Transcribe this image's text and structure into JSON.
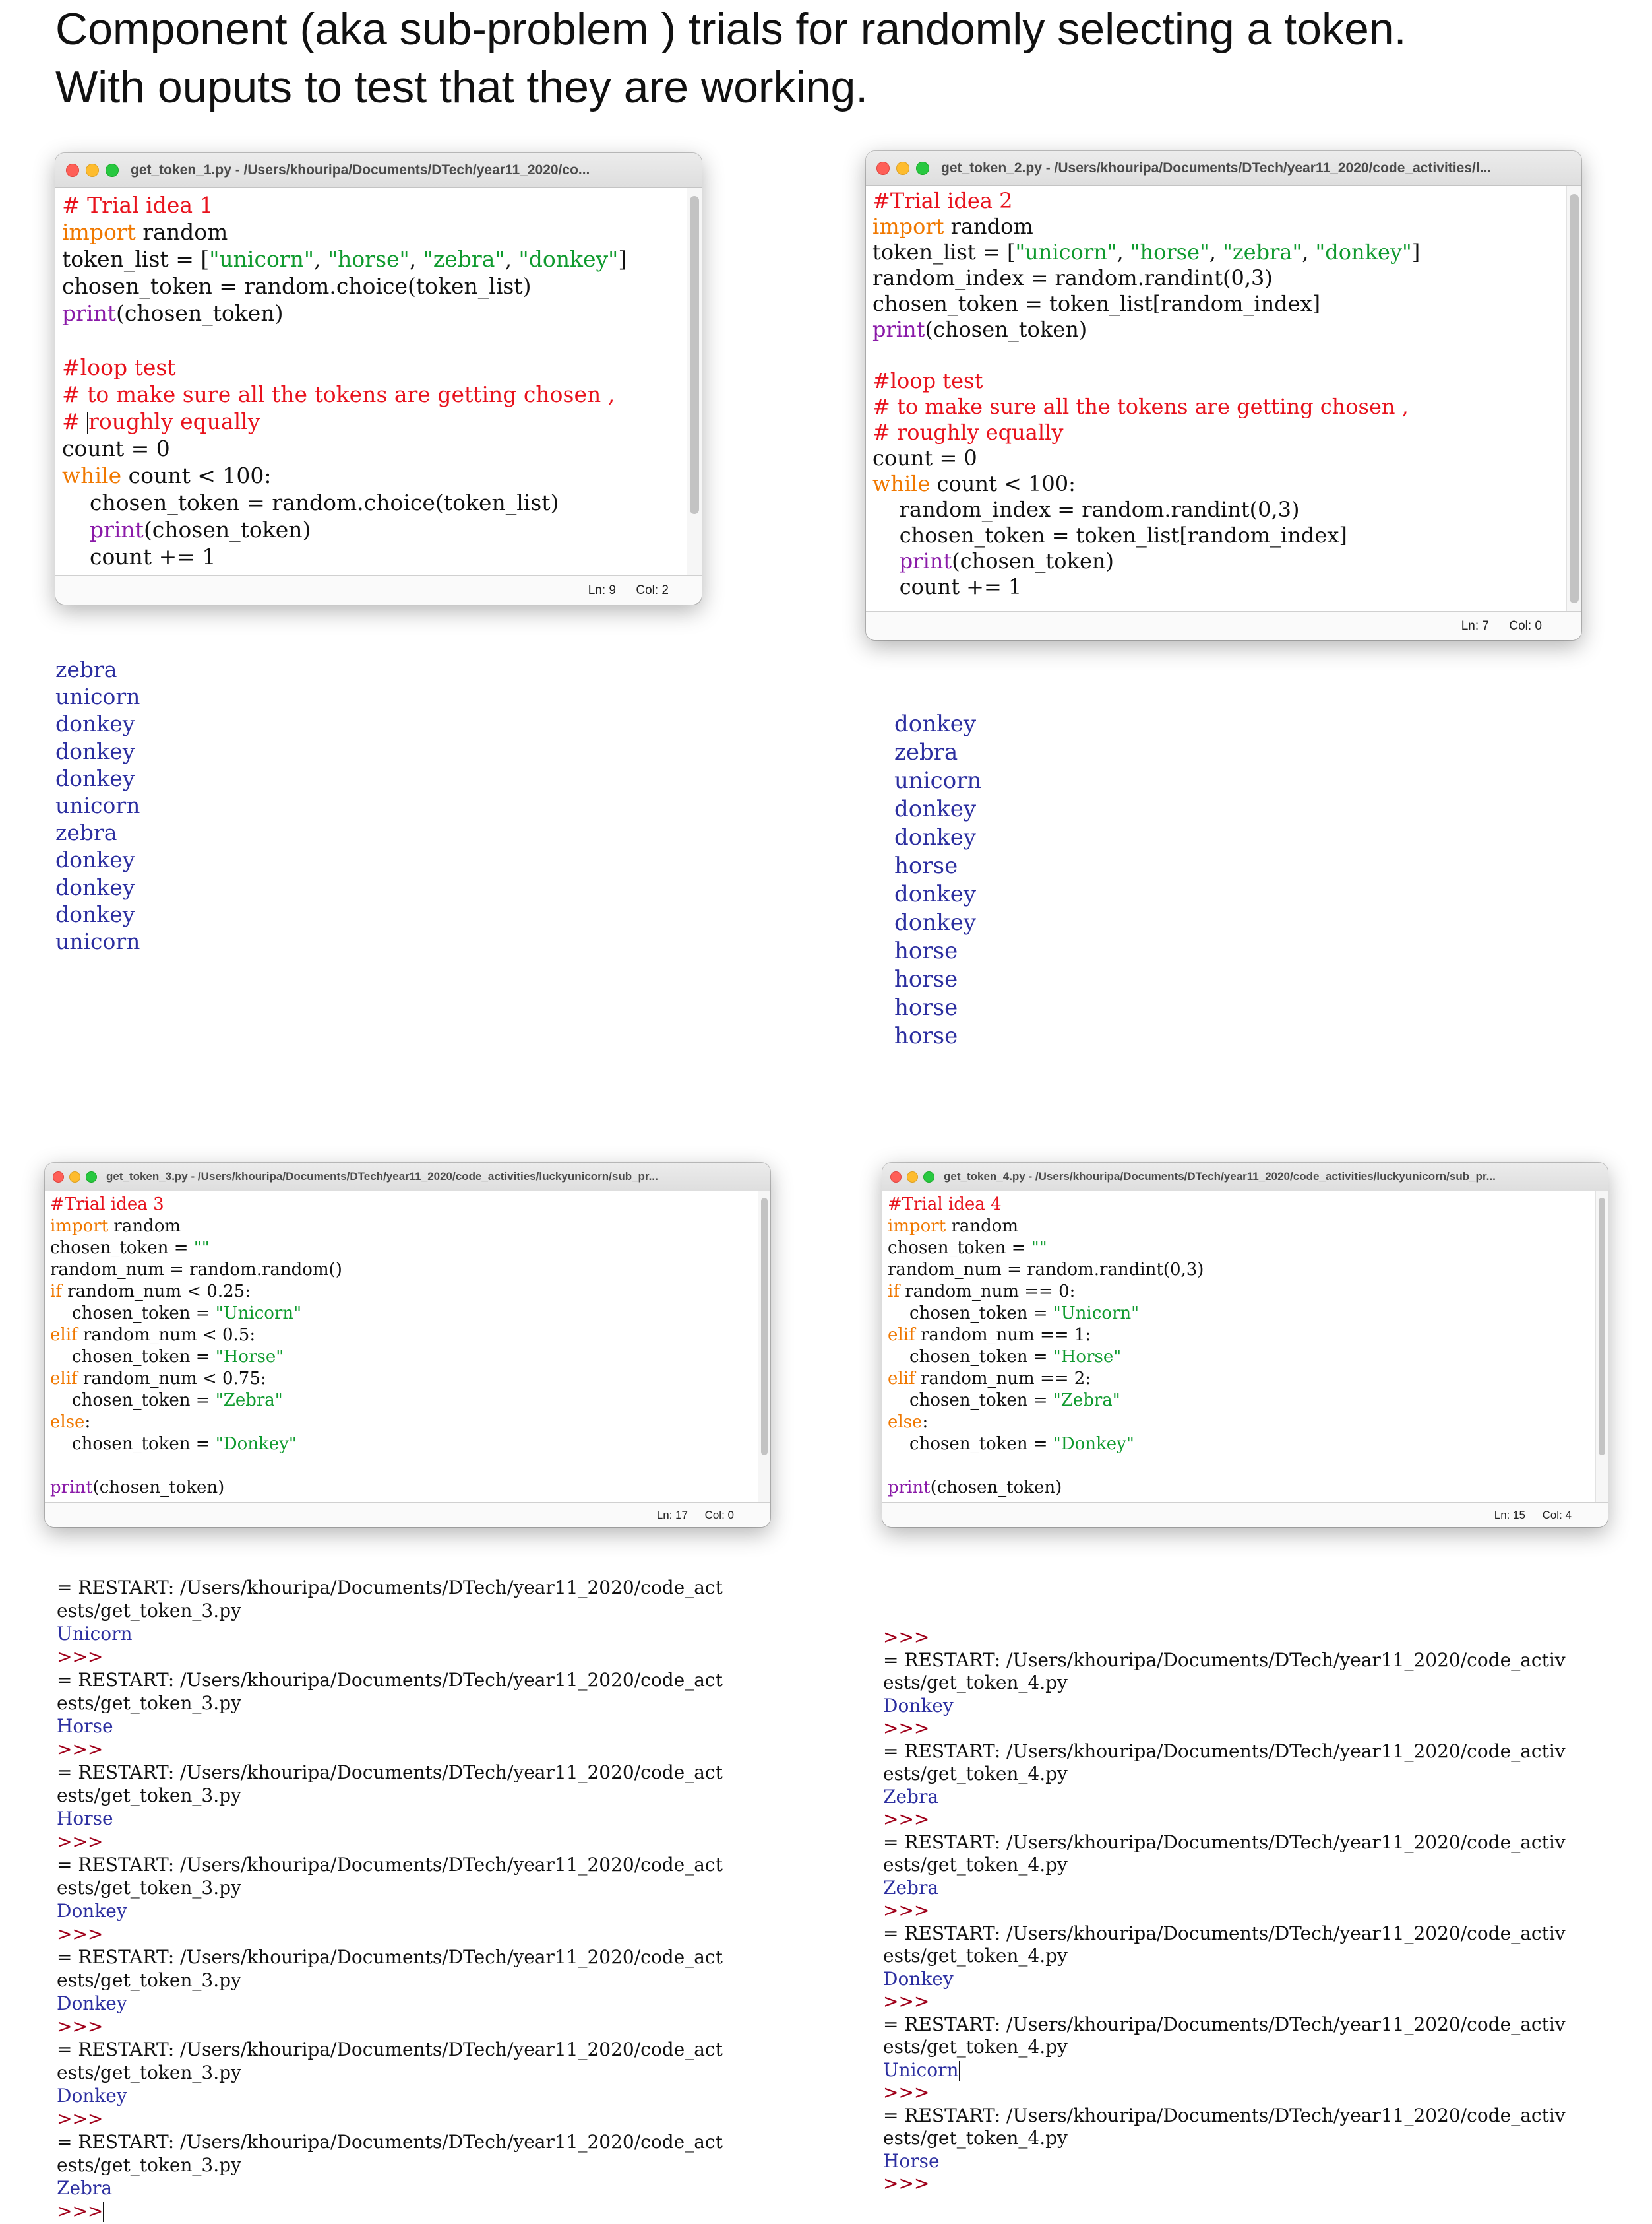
{
  "heading": {
    "line1": "Component (aka sub-problem ) trials for  randomly selecting a token.",
    "line2": "With ouputs to test that they are working."
  },
  "windows": [
    {
      "title": "get_token_1.py - /Users/khouripa/Documents/DTech/year11_2020/co...",
      "status_ln": "Ln: 9",
      "status_col": "Col: 2",
      "code": [
        [
          {
            "t": "# Trial idea 1",
            "c": "cm"
          }
        ],
        [
          {
            "t": "import",
            "c": "kw"
          },
          {
            "t": " random"
          }
        ],
        [
          {
            "t": "token_list = ["
          },
          {
            "t": "\"unicorn\"",
            "c": "st"
          },
          {
            "t": ", "
          },
          {
            "t": "\"horse\"",
            "c": "st"
          },
          {
            "t": ", "
          },
          {
            "t": "\"zebra\"",
            "c": "st"
          },
          {
            "t": ", "
          },
          {
            "t": "\"donkey\"",
            "c": "st"
          },
          {
            "t": "]"
          }
        ],
        [
          {
            "t": "chosen_token = random.choice(token_list)"
          }
        ],
        [
          {
            "t": "print",
            "c": "bi"
          },
          {
            "t": "(chosen_token)"
          }
        ],
        [],
        [
          {
            "t": "#loop test",
            "c": "cm"
          }
        ],
        [
          {
            "t": "# to make sure all the tokens are getting chosen ,",
            "c": "cm"
          }
        ],
        [
          {
            "t": "# ",
            "c": "cm"
          },
          {
            "caret": true
          },
          {
            "t": "roughly equally",
            "c": "cm"
          }
        ],
        [
          {
            "t": "count = 0"
          }
        ],
        [
          {
            "t": "while",
            "c": "kw"
          },
          {
            "t": " count < 100:"
          }
        ],
        [
          {
            "t": "    chosen_token = random.choice(token_list)"
          }
        ],
        [
          {
            "t": "    "
          },
          {
            "t": "print",
            "c": "bi"
          },
          {
            "t": "(chosen_token)"
          }
        ],
        [
          {
            "t": "    count += 1"
          }
        ]
      ]
    },
    {
      "title": "get_token_2.py - /Users/khouripa/Documents/DTech/year11_2020/code_activities/l...",
      "status_ln": "Ln: 7",
      "status_col": "Col: 0",
      "code": [
        [
          {
            "t": "#Trial idea 2",
            "c": "cm"
          }
        ],
        [
          {
            "t": "import",
            "c": "kw"
          },
          {
            "t": " random"
          }
        ],
        [
          {
            "t": "token_list = ["
          },
          {
            "t": "\"unicorn\"",
            "c": "st"
          },
          {
            "t": ", "
          },
          {
            "t": "\"horse\"",
            "c": "st"
          },
          {
            "t": ", "
          },
          {
            "t": "\"zebra\"",
            "c": "st"
          },
          {
            "t": ", "
          },
          {
            "t": "\"donkey\"",
            "c": "st"
          },
          {
            "t": "]"
          }
        ],
        [
          {
            "t": "random_index = random.randint(0,3)"
          }
        ],
        [
          {
            "t": "chosen_token = token_list[random_index]"
          }
        ],
        [
          {
            "t": "print",
            "c": "bi"
          },
          {
            "t": "(chosen_token)"
          }
        ],
        [],
        [
          {
            "t": "#loop test",
            "c": "cm"
          }
        ],
        [
          {
            "t": "# to make sure all the tokens are getting chosen ,",
            "c": "cm"
          }
        ],
        [
          {
            "t": "# roughly equally",
            "c": "cm"
          }
        ],
        [
          {
            "t": "count = 0"
          }
        ],
        [
          {
            "t": "while",
            "c": "kw"
          },
          {
            "t": " count < 100:"
          }
        ],
        [
          {
            "t": "    random_index = random.randint(0,3)"
          }
        ],
        [
          {
            "t": "    chosen_token = token_list[random_index]"
          }
        ],
        [
          {
            "t": "    "
          },
          {
            "t": "print",
            "c": "bi"
          },
          {
            "t": "(chosen_token)"
          }
        ],
        [
          {
            "t": "    count += 1"
          }
        ]
      ]
    },
    {
      "title": "get_token_3.py - /Users/khouripa/Documents/DTech/year11_2020/code_activities/luckyunicorn/sub_pr...",
      "status_ln": "Ln: 17",
      "status_col": "Col: 0",
      "code": [
        [
          {
            "t": "#Trial idea 3",
            "c": "cm"
          }
        ],
        [
          {
            "t": "import",
            "c": "kw"
          },
          {
            "t": " random"
          }
        ],
        [
          {
            "t": "chosen_token = "
          },
          {
            "t": "\"\"",
            "c": "st"
          }
        ],
        [
          {
            "t": "random_num = random.random()"
          }
        ],
        [
          {
            "t": "if",
            "c": "kw"
          },
          {
            "t": " random_num < 0.25:"
          }
        ],
        [
          {
            "t": "    chosen_token = "
          },
          {
            "t": "\"Unicorn\"",
            "c": "st"
          }
        ],
        [
          {
            "t": "elif",
            "c": "kw"
          },
          {
            "t": " random_num < 0.5:"
          }
        ],
        [
          {
            "t": "    chosen_token = "
          },
          {
            "t": "\"Horse\"",
            "c": "st"
          }
        ],
        [
          {
            "t": "elif",
            "c": "kw"
          },
          {
            "t": " random_num < 0.75:"
          }
        ],
        [
          {
            "t": "    chosen_token = "
          },
          {
            "t": "\"Zebra\"",
            "c": "st"
          }
        ],
        [
          {
            "t": "else",
            "c": "kw"
          },
          {
            "t": ":"
          }
        ],
        [
          {
            "t": "    chosen_token = "
          },
          {
            "t": "\"Donkey\"",
            "c": "st"
          }
        ],
        [],
        [
          {
            "t": "print",
            "c": "bi"
          },
          {
            "t": "(chosen_token)"
          }
        ]
      ]
    },
    {
      "title": "get_token_4.py - /Users/khouripa/Documents/DTech/year11_2020/code_activities/luckyunicorn/sub_pr...",
      "status_ln": "Ln: 15",
      "status_col": "Col: 4",
      "code": [
        [
          {
            "t": "#Trial idea 4",
            "c": "cm"
          }
        ],
        [
          {
            "t": "import",
            "c": "kw"
          },
          {
            "t": " random"
          }
        ],
        [
          {
            "t": "chosen_token = "
          },
          {
            "t": "\"\"",
            "c": "st"
          }
        ],
        [
          {
            "t": "random_num = random.randint(0,3)"
          }
        ],
        [
          {
            "t": "if",
            "c": "kw"
          },
          {
            "t": " random_num == 0:"
          }
        ],
        [
          {
            "t": "    chosen_token = "
          },
          {
            "t": "\"Unicorn\"",
            "c": "st"
          }
        ],
        [
          {
            "t": "elif",
            "c": "kw"
          },
          {
            "t": " random_num == 1:"
          }
        ],
        [
          {
            "t": "    chosen_token = "
          },
          {
            "t": "\"Horse\"",
            "c": "st"
          }
        ],
        [
          {
            "t": "elif",
            "c": "kw"
          },
          {
            "t": " random_num == 2:"
          }
        ],
        [
          {
            "t": "    chosen_token = "
          },
          {
            "t": "\"Zebra\"",
            "c": "st"
          }
        ],
        [
          {
            "t": "else",
            "c": "kw"
          },
          {
            "t": ":"
          }
        ],
        [
          {
            "t": "    chosen_token = "
          },
          {
            "t": "\"Donkey\"",
            "c": "st"
          }
        ],
        [],
        [
          {
            "t": "print",
            "c": "bi"
          },
          {
            "t": "(chosen_token)"
          }
        ]
      ]
    }
  ],
  "outputs": [
    [
      [
        {
          "t": "zebra",
          "c": "tok"
        }
      ],
      [
        {
          "t": "unicorn",
          "c": "tok"
        }
      ],
      [
        {
          "t": "donkey",
          "c": "tok"
        }
      ],
      [
        {
          "t": "donkey",
          "c": "tok"
        }
      ],
      [
        {
          "t": "donkey",
          "c": "tok"
        }
      ],
      [
        {
          "t": "unicorn",
          "c": "tok"
        }
      ],
      [
        {
          "t": "zebra",
          "c": "tok"
        }
      ],
      [
        {
          "t": "donkey",
          "c": "tok"
        }
      ],
      [
        {
          "t": "donkey",
          "c": "tok"
        }
      ],
      [
        {
          "t": "donkey",
          "c": "tok"
        }
      ],
      [
        {
          "t": "unicorn",
          "c": "tok"
        }
      ]
    ],
    [
      [
        {
          "t": "donkey",
          "c": "tok"
        }
      ],
      [
        {
          "t": "zebra",
          "c": "tok"
        }
      ],
      [
        {
          "t": "unicorn",
          "c": "tok"
        }
      ],
      [
        {
          "t": "donkey",
          "c": "tok"
        }
      ],
      [
        {
          "t": "donkey",
          "c": "tok"
        }
      ],
      [
        {
          "t": "horse",
          "c": "tok"
        }
      ],
      [
        {
          "t": "donkey",
          "c": "tok"
        }
      ],
      [
        {
          "t": "donkey",
          "c": "tok"
        }
      ],
      [
        {
          "t": "horse",
          "c": "tok"
        }
      ],
      [
        {
          "t": "horse",
          "c": "tok"
        }
      ],
      [
        {
          "t": "horse",
          "c": "tok"
        }
      ],
      [
        {
          "t": "horse",
          "c": "tok"
        }
      ]
    ],
    [
      [
        {
          "t": "= RESTART: /Users/khouripa/Documents/DTech/year11_2020/code_act",
          "c": "rs"
        }
      ],
      [
        {
          "t": "ests/get_token_3.py",
          "c": "rs"
        }
      ],
      [
        {
          "t": "Unicorn",
          "c": "tok"
        }
      ],
      [
        {
          "t": ">>>",
          "c": "prompt"
        }
      ],
      [
        {
          "t": "= RESTART: /Users/khouripa/Documents/DTech/year11_2020/code_act",
          "c": "rs"
        }
      ],
      [
        {
          "t": "ests/get_token_3.py",
          "c": "rs"
        }
      ],
      [
        {
          "t": "Horse",
          "c": "tok"
        }
      ],
      [
        {
          "t": ">>>",
          "c": "prompt"
        }
      ],
      [
        {
          "t": "= RESTART: /Users/khouripa/Documents/DTech/year11_2020/code_act",
          "c": "rs"
        }
      ],
      [
        {
          "t": "ests/get_token_3.py",
          "c": "rs"
        }
      ],
      [
        {
          "t": "Horse",
          "c": "tok"
        }
      ],
      [
        {
          "t": ">>>",
          "c": "prompt"
        }
      ],
      [
        {
          "t": "= RESTART: /Users/khouripa/Documents/DTech/year11_2020/code_act",
          "c": "rs"
        }
      ],
      [
        {
          "t": "ests/get_token_3.py",
          "c": "rs"
        }
      ],
      [
        {
          "t": "Donkey",
          "c": "tok"
        }
      ],
      [
        {
          "t": ">>>",
          "c": "prompt"
        }
      ],
      [
        {
          "t": "= RESTART: /Users/khouripa/Documents/DTech/year11_2020/code_act",
          "c": "rs"
        }
      ],
      [
        {
          "t": "ests/get_token_3.py",
          "c": "rs"
        }
      ],
      [
        {
          "t": "Donkey",
          "c": "tok"
        }
      ],
      [
        {
          "t": ">>>",
          "c": "prompt"
        }
      ],
      [
        {
          "t": "= RESTART: /Users/khouripa/Documents/DTech/year11_2020/code_act",
          "c": "rs"
        }
      ],
      [
        {
          "t": "ests/get_token_3.py",
          "c": "rs"
        }
      ],
      [
        {
          "t": "Donkey",
          "c": "tok"
        }
      ],
      [
        {
          "t": ">>>",
          "c": "prompt"
        }
      ],
      [
        {
          "t": "= RESTART: /Users/khouripa/Documents/DTech/year11_2020/code_act",
          "c": "rs"
        }
      ],
      [
        {
          "t": "ests/get_token_3.py",
          "c": "rs"
        }
      ],
      [
        {
          "t": "Zebra",
          "c": "tok"
        }
      ],
      [
        {
          "t": ">>>",
          "c": "prompt"
        },
        {
          "caret": true
        }
      ]
    ],
    [
      [
        {
          "t": ">>>",
          "c": "prompt"
        }
      ],
      [
        {
          "t": "= RESTART: /Users/khouripa/Documents/DTech/year11_2020/code_activ",
          "c": "rs"
        }
      ],
      [
        {
          "t": "ests/get_token_4.py",
          "c": "rs"
        }
      ],
      [
        {
          "t": "Donkey",
          "c": "tok"
        }
      ],
      [
        {
          "t": ">>>",
          "c": "prompt"
        }
      ],
      [
        {
          "t": "= RESTART: /Users/khouripa/Documents/DTech/year11_2020/code_activ",
          "c": "rs"
        }
      ],
      [
        {
          "t": "ests/get_token_4.py",
          "c": "rs"
        }
      ],
      [
        {
          "t": "Zebra",
          "c": "tok"
        }
      ],
      [
        {
          "t": ">>>",
          "c": "prompt"
        }
      ],
      [
        {
          "t": "= RESTART: /Users/khouripa/Documents/DTech/year11_2020/code_activ",
          "c": "rs"
        }
      ],
      [
        {
          "t": "ests/get_token_4.py",
          "c": "rs"
        }
      ],
      [
        {
          "t": "Zebra",
          "c": "tok"
        }
      ],
      [
        {
          "t": ">>>",
          "c": "prompt"
        }
      ],
      [
        {
          "t": "= RESTART: /Users/khouripa/Documents/DTech/year11_2020/code_activ",
          "c": "rs"
        }
      ],
      [
        {
          "t": "ests/get_token_4.py",
          "c": "rs"
        }
      ],
      [
        {
          "t": "Donkey",
          "c": "tok"
        }
      ],
      [
        {
          "t": ">>>",
          "c": "prompt"
        }
      ],
      [
        {
          "t": "= RESTART: /Users/khouripa/Documents/DTech/year11_2020/code_activ",
          "c": "rs"
        }
      ],
      [
        {
          "t": "ests/get_token_4.py",
          "c": "rs"
        }
      ],
      [
        {
          "t": "Unicorn",
          "c": "tok"
        },
        {
          "caret": true
        }
      ],
      [
        {
          "t": ">>>",
          "c": "prompt"
        }
      ],
      [
        {
          "t": "= RESTART: /Users/khouripa/Documents/DTech/year11_2020/code_activ",
          "c": "rs"
        }
      ],
      [
        {
          "t": "ests/get_token_4.py",
          "c": "rs"
        }
      ],
      [
        {
          "t": "Horse",
          "c": "tok"
        }
      ],
      [
        {
          "t": ">>>",
          "c": "prompt"
        }
      ]
    ]
  ],
  "colors": {
    "keyword": "#f07800",
    "builtin": "#8a1aa8",
    "string": "#0f9a2e",
    "comment": "#e8121c",
    "output_token": "#2c2fa0",
    "prompt": "#a0001a"
  }
}
